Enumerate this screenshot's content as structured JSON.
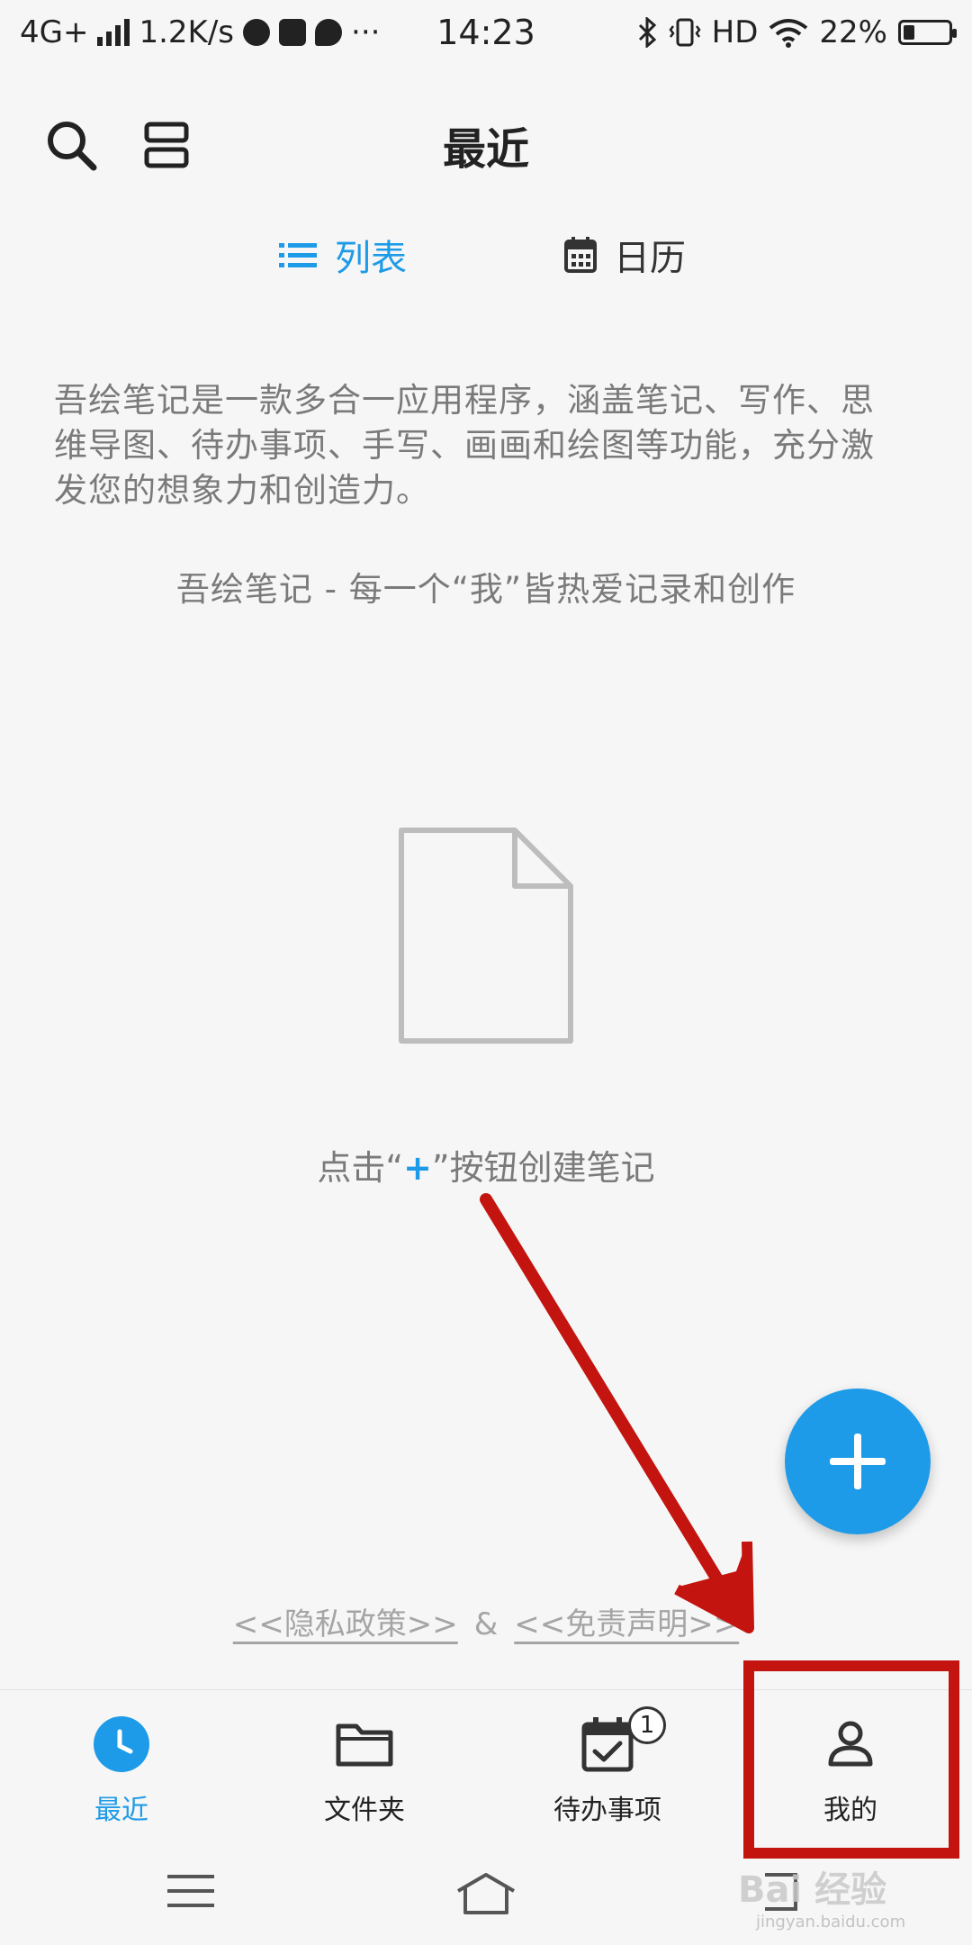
{
  "status_bar": {
    "network": "4G+",
    "speed": "1.2K/s",
    "time": "14:23",
    "hd": "HD",
    "battery": "22%",
    "battery_level": 0.22
  },
  "header": {
    "title": "最近"
  },
  "view_tabs": {
    "list_label": "列表",
    "calendar_label": "日历"
  },
  "intro": {
    "description": "吾绘笔记是一款多合一应用程序，涵盖笔记、写作、思维导图、待办事项、手写、画画和绘图等功能，充分激发您的想象力和创造力。",
    "slogan": "吾绘笔记 - 每一个“我”皆热爱记录和创作"
  },
  "empty_state": {
    "hint_before": "点击“",
    "hint_plus": "+",
    "hint_after": "”按钮创建笔记"
  },
  "links": {
    "privacy": "<<隐私政策>>",
    "amp": "&",
    "disclaimer": "<<免责声明>>"
  },
  "bottom_nav": {
    "items": [
      {
        "label": "最近",
        "icon": "clock-icon",
        "active": true
      },
      {
        "label": "文件夹",
        "icon": "folder-icon"
      },
      {
        "label": "待办事项",
        "icon": "calendar-check-icon",
        "badge": "1"
      },
      {
        "label": "我的",
        "icon": "person-icon"
      }
    ]
  },
  "watermark": {
    "text": "Bai 经验",
    "sub": "jingyan.baidu.com"
  },
  "colors": {
    "accent": "#1e9be8",
    "annotation": "#c3140f"
  }
}
